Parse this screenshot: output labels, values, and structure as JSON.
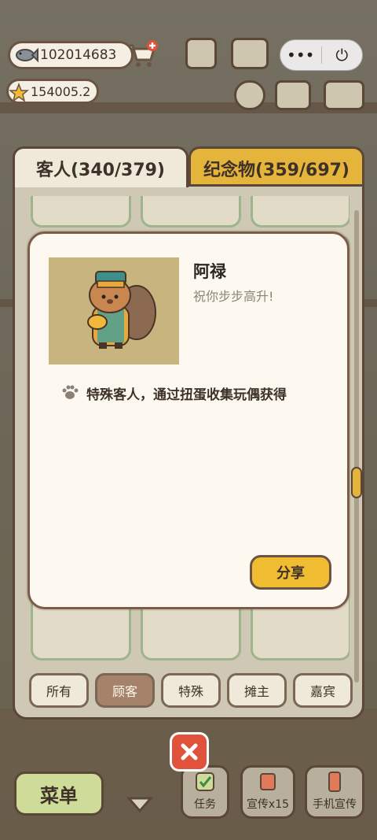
{
  "hud": {
    "fish_amount": "102014683",
    "star_amount": "154005.2"
  },
  "miniprogram": {
    "more_icon": "•••",
    "power_icon": "⏻"
  },
  "tabs": [
    {
      "label": "客人(340/379)",
      "active": true
    },
    {
      "label": "纪念物(359/697)",
      "active": false
    }
  ],
  "filters": [
    {
      "label": "所有",
      "active": false
    },
    {
      "label": "顾客",
      "active": true
    },
    {
      "label": "特殊",
      "active": false
    },
    {
      "label": "摊主",
      "active": false
    },
    {
      "label": "嘉宾",
      "active": false
    }
  ],
  "dialog": {
    "name": "阿禄",
    "motto": "祝你步步高升!",
    "description": "特殊客人，通过扭蛋收集玩偶获得",
    "share_label": "分享"
  },
  "bottom": {
    "menu_label": "菜单",
    "tasks_label": "任务",
    "promo_label": "宣传x15",
    "phone_promo_label": "手机宣传"
  },
  "colors": {
    "accent_yellow": "#f0bc32",
    "panel_border": "#5b4737",
    "close_red": "#e0523c"
  }
}
